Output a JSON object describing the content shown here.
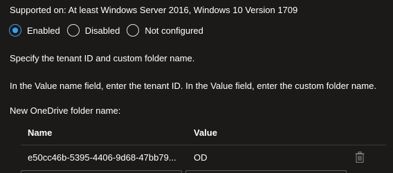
{
  "supported_on": "Supported on: At least Windows Server 2016, Windows 10 Version 1709",
  "options": {
    "enabled": "Enabled",
    "disabled": "Disabled",
    "not_configured": "Not configured",
    "selected": "Enabled"
  },
  "description": {
    "line1": "Specify the tenant ID and custom folder name.",
    "line2": "In the Value name field, enter the tenant ID. In the Value field, enter the custom folder name.",
    "field_label": "New OneDrive folder name:"
  },
  "table": {
    "headers": {
      "name": "Name",
      "value": "Value"
    },
    "rows": [
      {
        "name": "e50cc46b-5395-4406-9d68-47bb79...",
        "value": "OD"
      }
    ]
  },
  "icons": {
    "delete": "trash-icon"
  },
  "colors": {
    "background": "#1b1a19",
    "accent": "#3b9fed",
    "text": "#ffffff"
  }
}
